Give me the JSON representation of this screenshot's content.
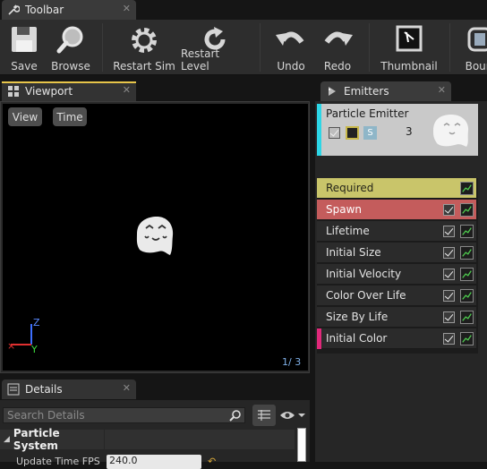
{
  "tabs": {
    "toolbar": {
      "label": "Toolbar",
      "close": "✕"
    },
    "viewport": {
      "label": "Viewport",
      "close": "✕"
    },
    "emitters": {
      "label": "Emitters",
      "close": "✕"
    },
    "details": {
      "label": "Details",
      "close": "✕"
    }
  },
  "toolbar": {
    "items": [
      {
        "label": "Save",
        "icon": "floppy-icon"
      },
      {
        "label": "Browse",
        "icon": "magnifier-icon"
      },
      {
        "label": "Restart Sim",
        "icon": "gear-icon"
      },
      {
        "label": "Restart Level",
        "icon": "refresh-icon"
      },
      {
        "label": "Undo",
        "icon": "undo-icon"
      },
      {
        "label": "Redo",
        "icon": "redo-icon"
      },
      {
        "label": "Thumbnail",
        "icon": "thumbnail-icon"
      },
      {
        "label": "Boun",
        "icon": "bounds-icon"
      }
    ]
  },
  "viewport": {
    "view_button": "View",
    "time_button": "Time",
    "lod": "1/  3",
    "axis_z": "Z",
    "axis_y": "Y"
  },
  "emitter": {
    "name": "Particle Emitter",
    "count": "3",
    "solo": "S"
  },
  "modules": [
    {
      "label": "Required",
      "color": "#c7c36a",
      "checkbox": false
    },
    {
      "label": "Spawn",
      "color": "#c45c5c",
      "checkbox": true
    },
    {
      "label": "Lifetime",
      "checkbox": true
    },
    {
      "label": "Initial Size",
      "checkbox": true
    },
    {
      "label": "Initial Velocity",
      "checkbox": true
    },
    {
      "label": "Color Over Life",
      "checkbox": true
    },
    {
      "label": "Size By Life",
      "checkbox": true
    },
    {
      "label": "Initial Color",
      "checkbox": true,
      "marker": "#e0287a"
    }
  ],
  "details": {
    "search_placeholder": "Search Details",
    "section": "Particle System",
    "prop_label": "Update Time FPS",
    "prop_value": "240.0"
  }
}
